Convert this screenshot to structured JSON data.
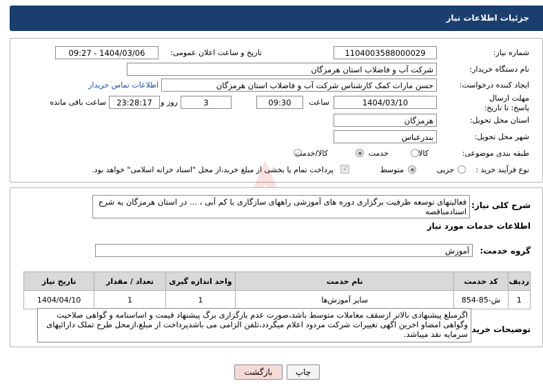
{
  "header": {
    "title": "جزئیات اطلاعات نیاز"
  },
  "need_number": {
    "label": "شماره نیاز:",
    "value": "1104003588000029"
  },
  "announce_datetime": {
    "label": "تاریخ و ساعت اعلان عمومی:",
    "value": "1404/03/06 - 09:27"
  },
  "buyer_org": {
    "label": "نام دستگاه خریدار:",
    "value": "شرکت آب و فاضلاب استان هرمزگان"
  },
  "requester": {
    "label": "ایجاد کننده درخواست:",
    "value": "حسن مارات کمک کارشناس شرکت آب و فاضلاب استان هرمزگان",
    "contact_link": "اطلاعات تماس خریدار"
  },
  "deadline": {
    "label": "مهلت ارسال پاسخ: تا تاریخ:",
    "date": "1404/03/10",
    "time_label": "ساعت",
    "time": "09:30",
    "days": "3",
    "days_label": "روز و",
    "remaining": "23:28:17",
    "remaining_label": "ساعت باقی مانده"
  },
  "delivery_province": {
    "label": "استان محل تحویل:",
    "value": "هرمزگان"
  },
  "delivery_city": {
    "label": "شهر محل تحویل:",
    "value": "بندرعباس"
  },
  "category": {
    "label": "طبقه بندی موضوعی:",
    "options": [
      "کالا",
      "خدمت",
      "کالا/خدمت"
    ],
    "selected": "خدمت"
  },
  "purchase_type": {
    "label": "نوع فرآیند خرید :",
    "options": [
      "جزیی",
      "متوسط"
    ],
    "selected": "متوسط",
    "payment_note": "پرداخت تمام یا بخشی از مبلغ خرید،از محل \"اسناد خزانه اسلامی\" خواهد بود."
  },
  "summary": {
    "label": "شرح کلی نیاز:",
    "value": "فعالیتهای توسعه ظرفیت برگزاری دوره های آموزشی راههای سازگاری با کم آبی ، ... در استان هرمزگان به شرح اسنادمناقصه"
  },
  "services_title": "اطلاعات خدمات مورد نیاز",
  "service_group": {
    "label": "گروه خدمت:",
    "value": "آموزش"
  },
  "table": {
    "headers": [
      "ردیف",
      "کد خدمت",
      "نام خدمت",
      "واحد اندازه گیری",
      "تعداد / مقدار",
      "تاریخ نیاز"
    ],
    "rows": [
      [
        "1",
        "ش-85-854",
        "سایر آموزش‌ها",
        "1",
        "1",
        "1404/04/10"
      ]
    ]
  },
  "buyer_notes": {
    "label": "توضیحات خریدار:",
    "value": "اگرمبلغ پیشنهادی بالاتر ازسقف معاملات متوسط باشد،صورت عدم بارگزاری برگ پیشنهاد قیمت و اساسنامه و گواهی صلاحیت وگواهی امضاو اخرین اگهی تغییرات شرکت مردود اعلام میگردد،تلفن الزامی می باشدپرداخت از مبلغ،ازمحل طرح تملک دارائیهای سرمایه نقد میباشد."
  },
  "buttons": {
    "print": "چاپ",
    "back": "بازگشت"
  },
  "colors": {
    "header_bg": "#1a3e6e",
    "back_button_bg": "#f6dada",
    "watermark": "#c81e1e"
  }
}
